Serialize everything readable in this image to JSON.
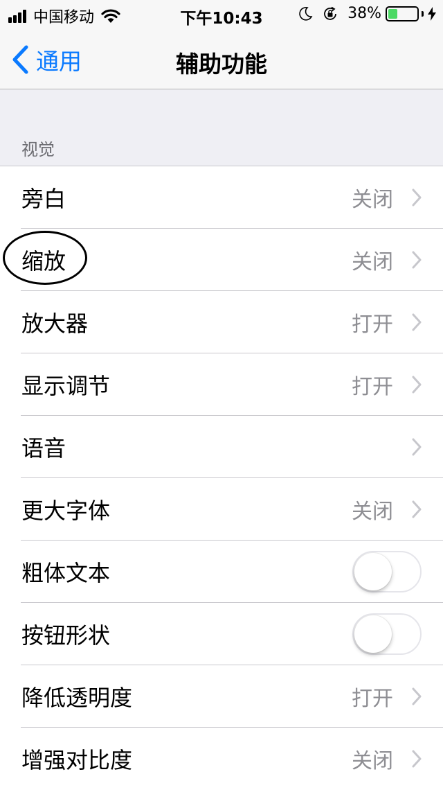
{
  "status_bar": {
    "carrier": "中国移动",
    "time": "下午10:43",
    "battery": "38%",
    "battery_level": 0.38,
    "icons": [
      "signal-icon",
      "wifi-icon",
      "moon-icon",
      "orientation-lock-icon",
      "battery-icon",
      "charging-bolt-icon"
    ]
  },
  "nav": {
    "back_label": "通用",
    "title": "辅助功能"
  },
  "section": {
    "header": "视觉"
  },
  "rows": [
    {
      "label": "旁白",
      "value": "关闭",
      "type": "link"
    },
    {
      "label": "缩放",
      "value": "关闭",
      "type": "link"
    },
    {
      "label": "放大器",
      "value": "打开",
      "type": "link"
    },
    {
      "label": "显示调节",
      "value": "打开",
      "type": "link"
    },
    {
      "label": "语音",
      "value": "",
      "type": "link"
    },
    {
      "label": "更大字体",
      "value": "关闭",
      "type": "link"
    },
    {
      "label": "粗体文本",
      "value": "",
      "type": "toggle",
      "on": false
    },
    {
      "label": "按钮形状",
      "value": "",
      "type": "toggle",
      "on": false
    },
    {
      "label": "降低透明度",
      "value": "打开",
      "type": "link"
    },
    {
      "label": "增强对比度",
      "value": "关闭",
      "type": "link"
    }
  ],
  "colors": {
    "accent": "#0a7aff",
    "battery_green": "#4cd964",
    "secondary_text": "#8e8e93"
  }
}
